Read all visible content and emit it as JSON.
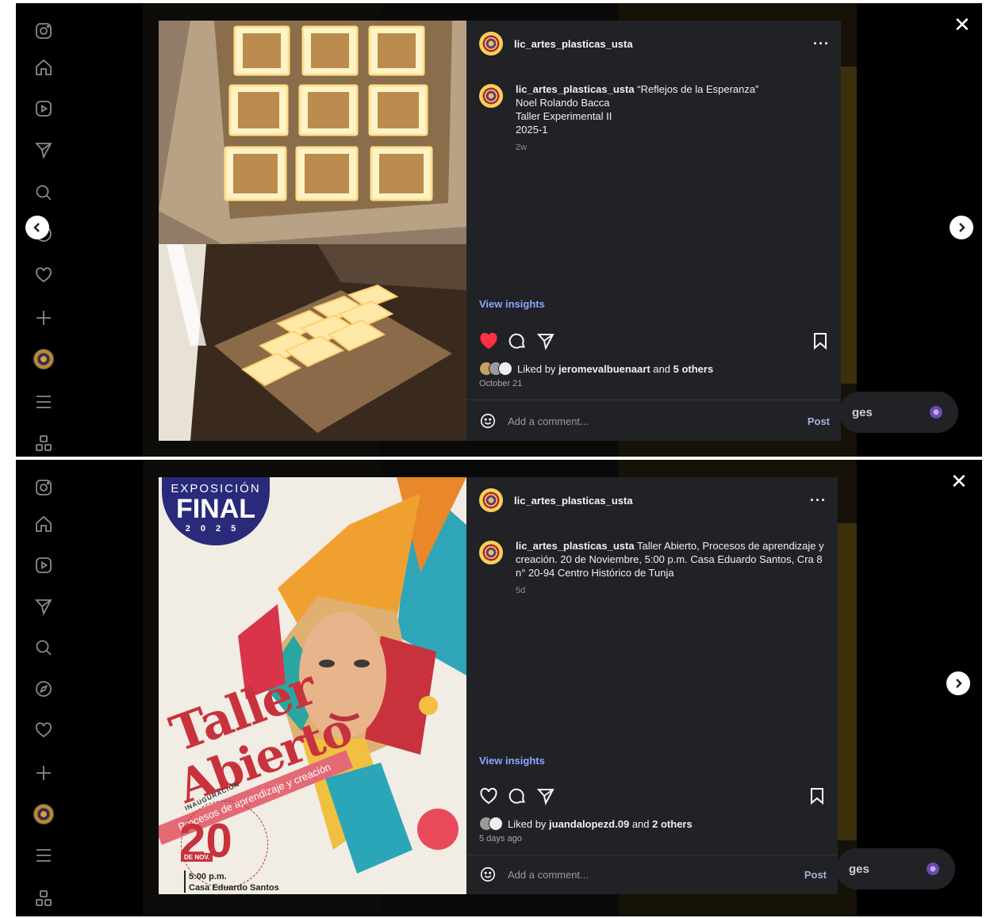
{
  "colors": {
    "modal_bg": "#202226",
    "link": "#8ea6ff",
    "heart_red": "#ff3040",
    "poster_red": "#c8323c",
    "poster_navy": "#2a2a7a"
  },
  "nav_icons": [
    "instagram-icon",
    "home-icon",
    "reels-icon",
    "messages-icon",
    "search-icon",
    "explore-icon",
    "heart-icon",
    "plus-icon",
    "profile-avatar",
    "menu-icon",
    "more-apps-icon"
  ],
  "posts": [
    {
      "username": "lic_artes_plasticas_usta",
      "more": "···",
      "caption_user": "lic_artes_plasticas_usta",
      "caption_lines": [
        "“Reflejos de la Esperanza”",
        "Noel Rolando Bacca",
        "Taller Experimental II",
        "2025-1"
      ],
      "age": "2w",
      "view_insights": "View insights",
      "liked": true,
      "liked_by_prefix": "Liked by",
      "liked_by_user": "jeromevalbuenaart",
      "liked_by_and": "and",
      "liked_by_others": "5 others",
      "date": "October 21",
      "comment_placeholder": "Add a comment...",
      "post_label": "Post",
      "messages_label": "ges"
    },
    {
      "username": "lic_artes_plasticas_usta",
      "more": "···",
      "caption_user": "lic_artes_plasticas_usta",
      "caption_text": "Taller Abierto, Procesos de aprendizaje y creación. 20 de Noviembre, 5:00 p.m. Casa Eduardo Santos, Cra 8 n° 20-94 Centro Histórico de Tunja",
      "age": "5d",
      "view_insights": "View insights",
      "liked": false,
      "liked_by_prefix": "Liked by",
      "liked_by_user": "juandalopezd.09",
      "liked_by_and": "and",
      "liked_by_others": "2 others",
      "date": "5 days ago",
      "comment_placeholder": "Add a comment...",
      "post_label": "Post",
      "messages_label": "ges",
      "poster": {
        "badge_top": "EXPOSICIÓN",
        "badge_main": "FINAL",
        "badge_year": "2025",
        "title_line1": "Taller",
        "title_line2": "Abierto",
        "ribbon": "Procesos de aprendizaje y creación",
        "inauguration": "INAUGURACIÓN",
        "day": "20",
        "month": "DE NOV.",
        "time": "5:00 p.m.",
        "place": "Casa Eduardo Santos"
      }
    }
  ],
  "close_label": "✕"
}
